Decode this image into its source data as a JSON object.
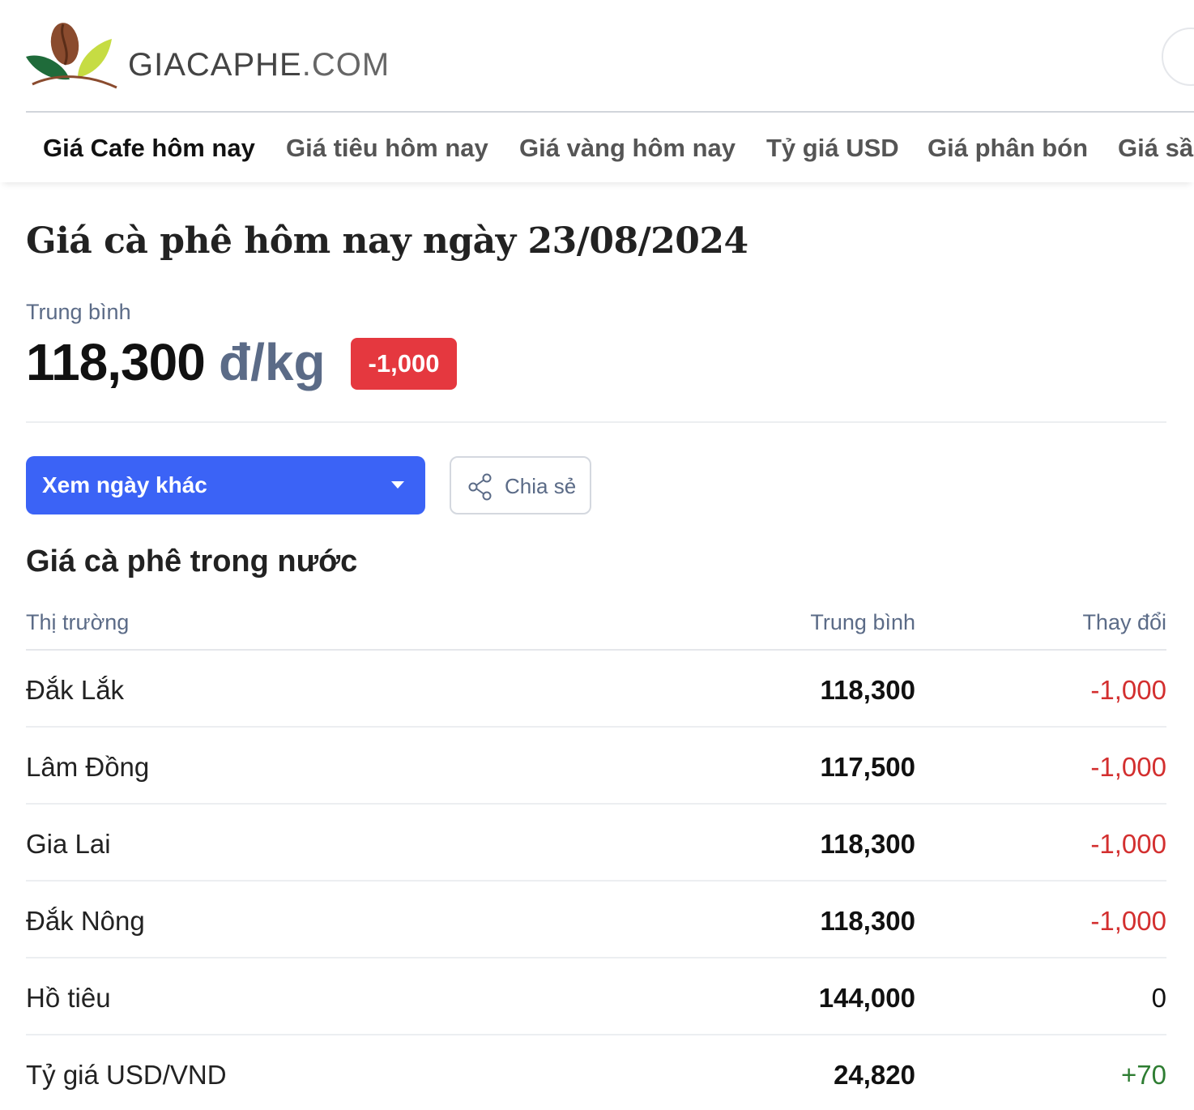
{
  "header": {
    "brand_name": "GIACAPHE",
    "brand_suffix": ".COM"
  },
  "nav": {
    "items": [
      {
        "label": "Giá Cafe hôm nay",
        "active": true
      },
      {
        "label": "Giá tiêu hôm nay",
        "active": false
      },
      {
        "label": "Giá vàng hôm nay",
        "active": false
      },
      {
        "label": "Tỷ giá USD",
        "active": false
      },
      {
        "label": "Giá phân bón",
        "active": false
      },
      {
        "label": "Giá sầ",
        "active": false
      }
    ]
  },
  "page": {
    "title": "Giá cà phê hôm nay ngày 23/08/2024"
  },
  "summary": {
    "label": "Trung bình",
    "value": "118,300",
    "unit": "đ/kg",
    "change": "-1,000"
  },
  "actions": {
    "date_button_label": "Xem ngày khác",
    "share_label": "Chia sẻ"
  },
  "domestic": {
    "title": "Giá cà phê trong nước",
    "headers": {
      "market": "Thị trường",
      "average": "Trung bình",
      "change": "Thay đổi"
    },
    "rows": [
      {
        "market": "Đắk Lắk",
        "average": "118,300",
        "change": "-1,000",
        "trend": "neg"
      },
      {
        "market": "Lâm Đồng",
        "average": "117,500",
        "change": "-1,000",
        "trend": "neg"
      },
      {
        "market": "Gia Lai",
        "average": "118,300",
        "change": "-1,000",
        "trend": "neg"
      },
      {
        "market": "Đắk Nông",
        "average": "118,300",
        "change": "-1,000",
        "trend": "neg"
      },
      {
        "market": "Hồ tiêu",
        "average": "144,000",
        "change": "0",
        "trend": "zero"
      },
      {
        "market": "Tỷ giá USD/VND",
        "average": "24,820",
        "change": "+70",
        "trend": "pos"
      }
    ]
  },
  "colors": {
    "accent_blue": "#3b63f6",
    "badge_red": "#e5383f",
    "negative": "#d32f2f",
    "positive": "#2e7d32",
    "muted": "#5b6b87"
  }
}
